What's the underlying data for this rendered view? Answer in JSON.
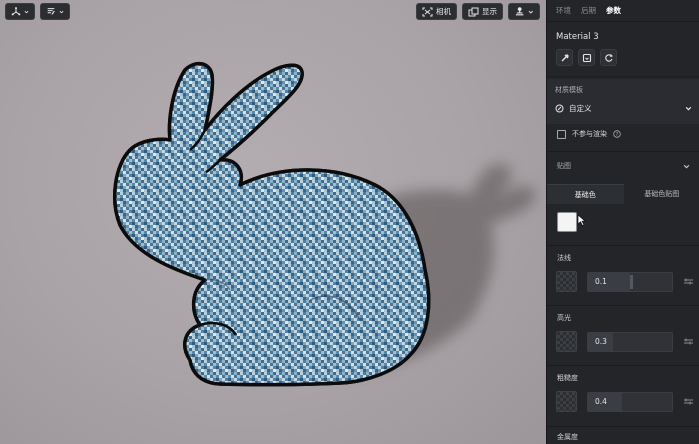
{
  "toolbar": {
    "camera_label": "相机",
    "display_label": "显示"
  },
  "panel": {
    "tabs": [
      {
        "label": "环境",
        "active": false
      },
      {
        "label": "后期",
        "active": false
      },
      {
        "label": "参数",
        "active": true
      }
    ],
    "material_name": "Material 3",
    "material_type_label": "材质模板",
    "material_type_value": "自定义",
    "exclude_render_label": "不参与渲染",
    "exclude_render_checked": false,
    "maps_label": "贴图",
    "subtabs": [
      {
        "label": "基础色",
        "active": true
      },
      {
        "label": "基础色贴图",
        "active": false
      }
    ],
    "base_color": "#f4f4f4",
    "params": [
      {
        "label": "法线",
        "value": "0.1",
        "fraction": 0.5
      },
      {
        "label": "高光",
        "value": "0.3",
        "fraction": 0.3
      },
      {
        "label": "粗糙度",
        "value": "0.4",
        "fraction": 0.4
      },
      {
        "label": "金属度",
        "value": "",
        "fraction": 0
      }
    ]
  },
  "colors": {
    "viewport_bg": "#aaa3a7",
    "panel_bg": "#232529",
    "bunny_blue": "#5d8ead"
  }
}
